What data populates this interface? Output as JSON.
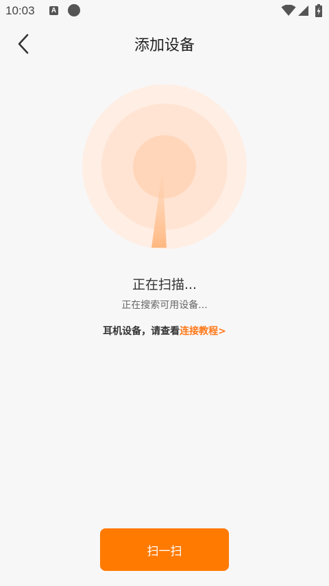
{
  "status_bar": {
    "time": "10:03",
    "a_icon_text": "A",
    "icons": [
      "a-notification-icon",
      "circle-notification-icon",
      "wifi-icon",
      "signal-icon",
      "battery-charging-icon"
    ]
  },
  "header": {
    "title": "添加设备",
    "back_icon": "chevron-left-icon"
  },
  "radar": {
    "icon": "radar-scan-icon",
    "colors": {
      "outer": "#ffeee4",
      "middle": "#ffe4d3",
      "inner": "#ffd6ba",
      "beam": "#ffbb8a"
    }
  },
  "scan": {
    "status": "正在扫描...",
    "substatus": "正在搜索可用设备..."
  },
  "tutorial": {
    "prefix": "耳机设备，请查看",
    "link": "连接教程>"
  },
  "scan_button": {
    "label": "扫一扫"
  },
  "colors": {
    "accent": "#ff7a00",
    "link": "#ff7a1a",
    "background": "#f7f7f8"
  }
}
